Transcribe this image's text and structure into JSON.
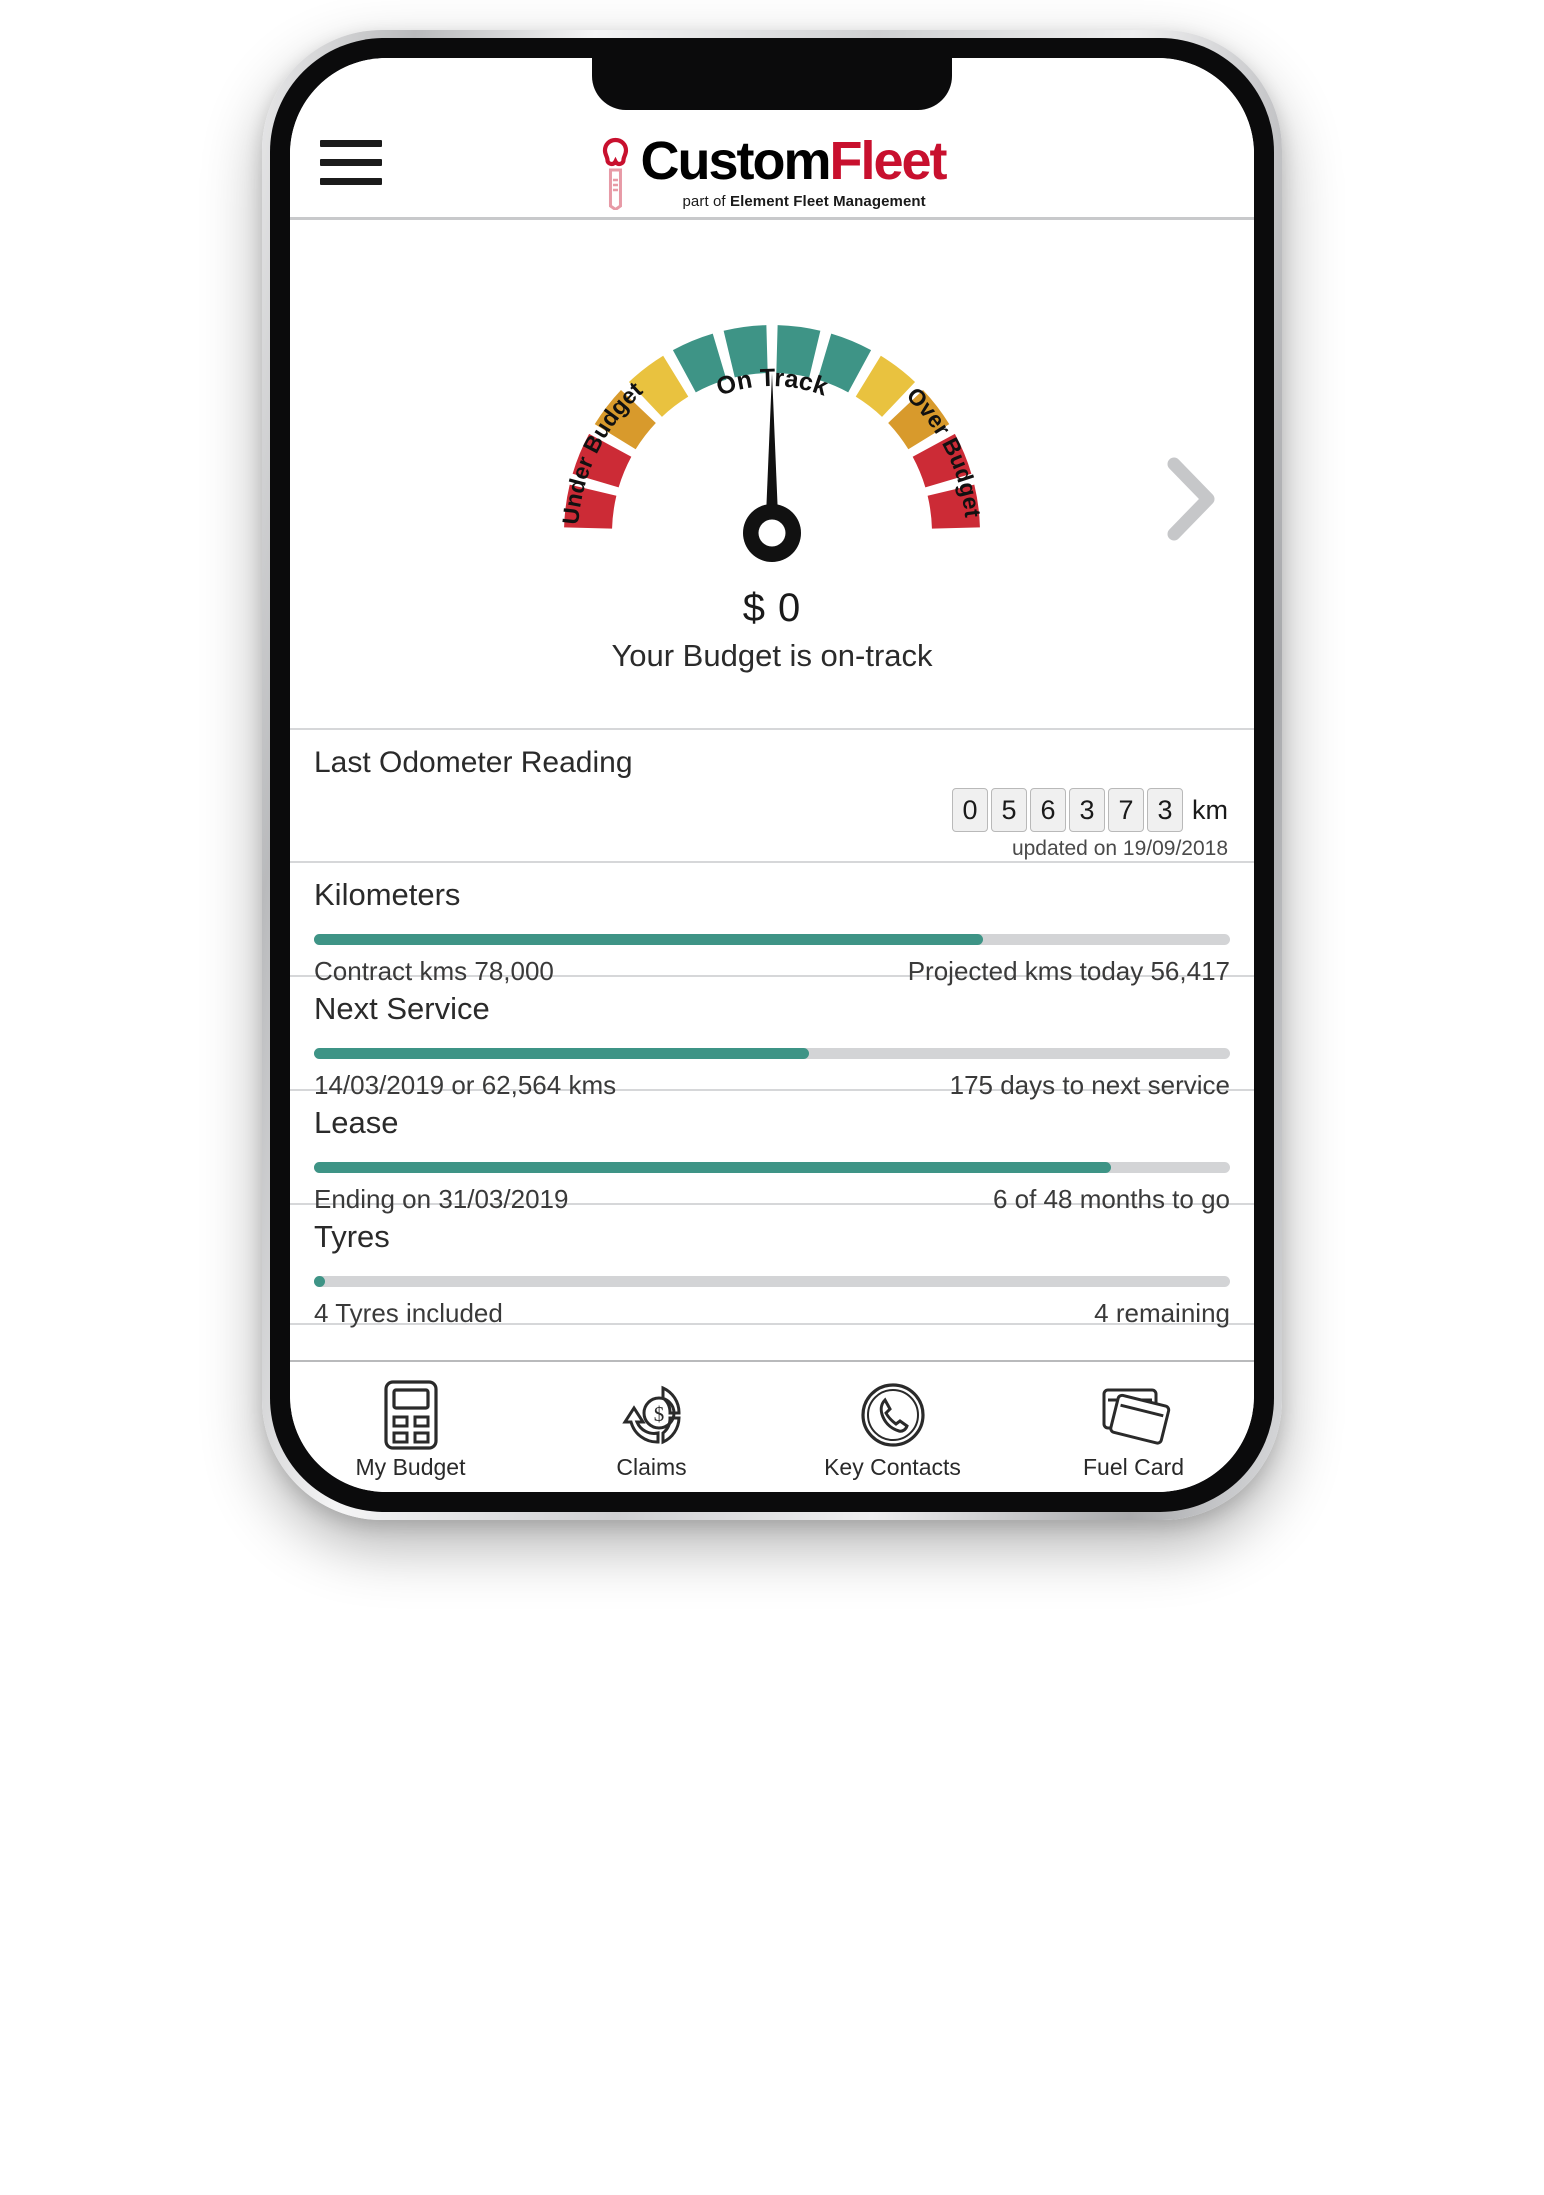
{
  "header": {
    "menu_icon": "hamburger-icon",
    "logo_primary": "Custom",
    "logo_secondary": "Fleet",
    "tagline_prefix": "part of ",
    "tagline_strong": "Element Fleet Management"
  },
  "budget_gauge": {
    "top_label": "On Track",
    "left_label": "Under Budget",
    "right_label": "Over Budget",
    "value": "$ 0",
    "status_text": "Your Budget is on-track",
    "next_icon": "chevron-right-icon",
    "needle_angle_deg": 0,
    "colors": {
      "teal": "#3E9486",
      "yellow": "#E9C23F",
      "orange": "#D89A2C",
      "red": "#CC2B36"
    },
    "segments": [
      "red",
      "red",
      "orange",
      "yellow",
      "teal",
      "teal",
      "teal",
      "teal",
      "yellow",
      "orange",
      "red",
      "red"
    ]
  },
  "odometer": {
    "title": "Last Odometer Reading",
    "digits": [
      "0",
      "5",
      "6",
      "3",
      "7",
      "3"
    ],
    "unit": "km",
    "updated": "updated on 19/09/2018"
  },
  "metrics": [
    {
      "title": "Kilometers",
      "left": "Contract kms 78,000",
      "right": "Projected kms today 56,417",
      "progress": 73
    },
    {
      "title": "Next Service",
      "left": "14/03/2019 or 62,564 kms",
      "right": "175 days to next service",
      "progress": 54
    },
    {
      "title": "Lease",
      "left": "Ending on 31/03/2019",
      "right": "6 of 48 months to go",
      "progress": 87
    },
    {
      "title": "Tyres",
      "left": "4 Tyres included",
      "right": "4 remaining",
      "progress": 1
    }
  ],
  "bottom_nav": [
    {
      "label": "My Budget",
      "icon": "calculator-icon"
    },
    {
      "label": "Claims",
      "icon": "refresh-dollar-icon"
    },
    {
      "label": "Key Contacts",
      "icon": "phone-circle-icon"
    },
    {
      "label": "Fuel Card",
      "icon": "credit-cards-icon"
    }
  ]
}
